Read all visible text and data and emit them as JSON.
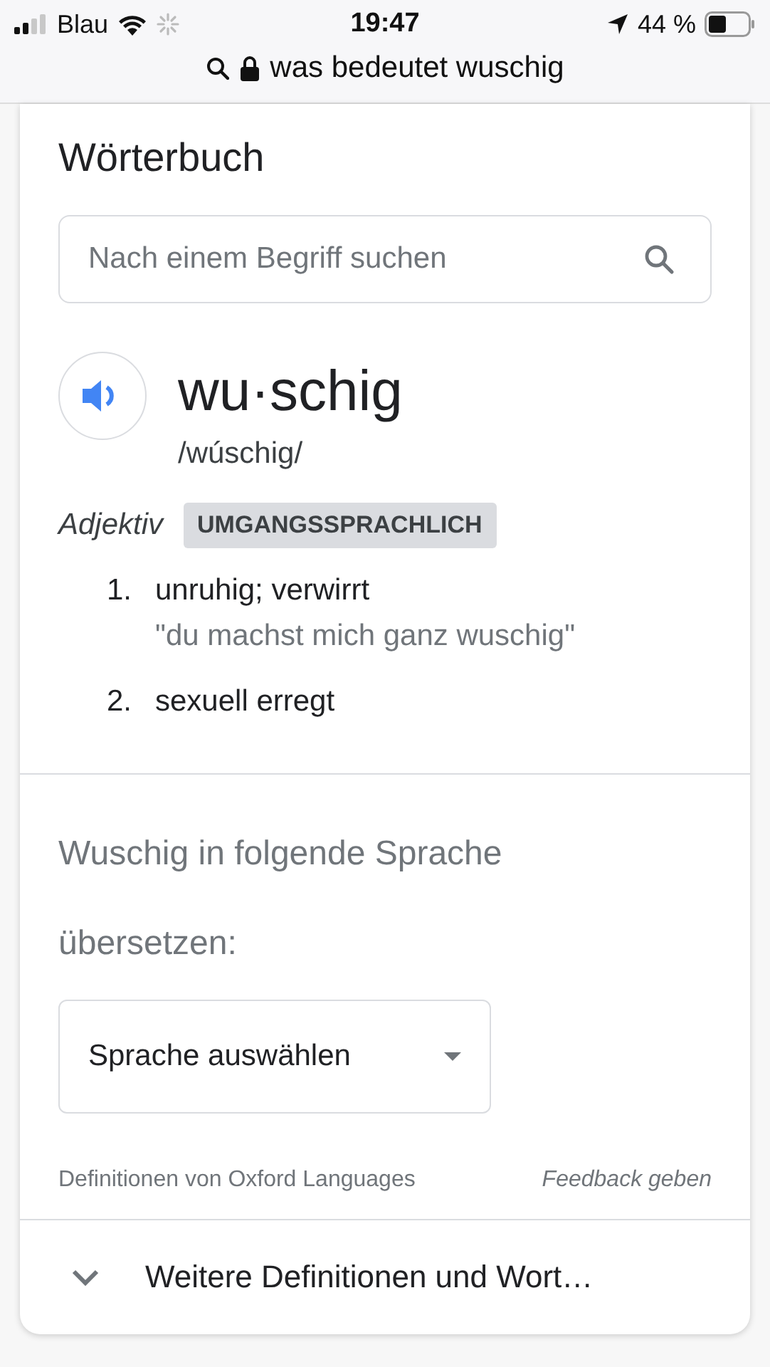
{
  "status_bar": {
    "carrier": "Blau",
    "time": "19:47",
    "battery": "44 %"
  },
  "address_bar": {
    "url": "was bedeutet wuschig"
  },
  "dictionary": {
    "title": "Wörterbuch",
    "search": {
      "placeholder": "Nach einem Begriff suchen"
    },
    "word": "wu·schig",
    "phonetic": "/wúschig/",
    "part_of_speech": "Adjektiv",
    "register": "UMGANGSSPRACHLICH",
    "definitions": [
      {
        "number": "1.",
        "text": "unruhig; verwirrt",
        "example": "\"du machst mich ganz wuschig\""
      },
      {
        "number": "2.",
        "text": "sexuell erregt"
      }
    ]
  },
  "translate": {
    "prompt": "Wuschig in folgende Sprache übersetzen:",
    "select": "Sprache auswählen"
  },
  "footer": {
    "source": "Definitionen von Oxford Languages",
    "feedback": "Feedback geben"
  },
  "more": {
    "label": "Weitere Definitionen und Wort…"
  }
}
